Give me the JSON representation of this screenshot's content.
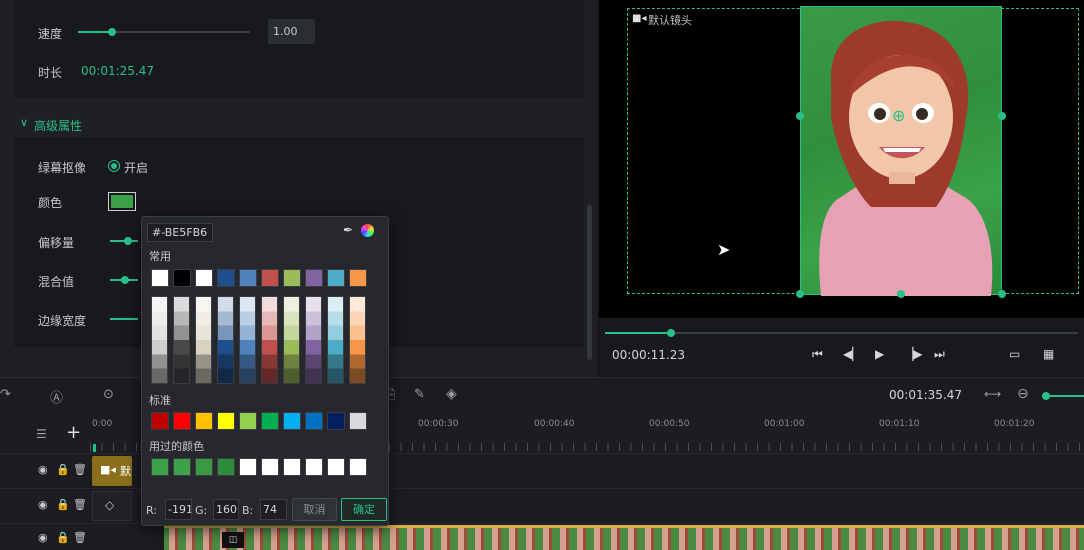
{
  "props": {
    "speed_label": "速度",
    "speed_value": "1.00",
    "duration_label": "时长",
    "duration_value": "00:01:25.47",
    "advanced_header": "高级属性",
    "chroma_label": "绿幕抠像",
    "chroma_toggle": "开启",
    "color_label": "颜色",
    "color_value_hex": "#3FA04A",
    "offset_label": "偏移量",
    "blend_label": "混合值",
    "edge_label": "边缘宽度"
  },
  "preview": {
    "camera_label": "默认镜头",
    "time_current": "00:00:11.23",
    "progress": 0.14
  },
  "toolbar": {
    "time_total": "00:01:35.47"
  },
  "ruler": {
    "labels": [
      "0:00",
      "00:00:30",
      "00:00:40",
      "00:00:50",
      "00:01:00",
      "00:01:10",
      "00:01:20"
    ]
  },
  "tracks": {
    "clip_label": "默"
  },
  "picker": {
    "hex_value": "#-BE5FB6",
    "common_title": "常用",
    "standard_title": "标准",
    "used_title": "用过的颜色",
    "r_label": "R:",
    "r_value": "-191",
    "g_label": "G:",
    "g_value": "160",
    "b_label": "B:",
    "b_value": "74",
    "cancel": "取消",
    "confirm": "确定",
    "common_colors": [
      "#ffffff",
      "#000000",
      "#ffffff",
      "#1f4e8c",
      "#4f81bd",
      "#c0504d",
      "#9bbb59",
      "#8064a2",
      "#4bacc6",
      "#f79646"
    ],
    "standard_colors": [
      "#c00000",
      "#ff0000",
      "#ffc000",
      "#ffff00",
      "#92d050",
      "#00b050",
      "#00b0f0",
      "#0070c0",
      "#002060",
      "#d9d9d9"
    ],
    "used_colors": [
      "#3fa04a",
      "#3fa04a",
      "#3a9a44",
      "#2f8a3a",
      "#ffffff",
      "#ffffff",
      "#ffffff",
      "#ffffff",
      "#ffffff",
      "#ffffff"
    ]
  }
}
